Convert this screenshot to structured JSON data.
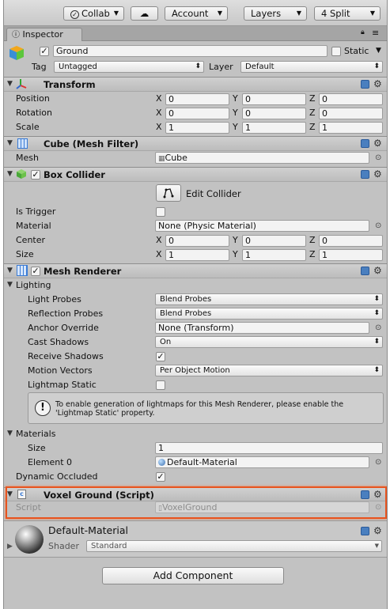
{
  "toolbar": {
    "collab": "Collab",
    "account": "Account",
    "layers": "Layers",
    "layout": "4 Split"
  },
  "tab": {
    "label": "Inspector"
  },
  "object": {
    "name": "Ground",
    "static_label": "Static",
    "tag_label": "Tag",
    "tag_value": "Untagged",
    "layer_label": "Layer",
    "layer_value": "Default"
  },
  "transform": {
    "title": "Transform",
    "position": "Position",
    "rotation": "Rotation",
    "scale": "Scale",
    "x": "X",
    "y": "Y",
    "z": "Z",
    "pos": [
      "0",
      "0",
      "0"
    ],
    "rot": [
      "0",
      "0",
      "0"
    ],
    "scl": [
      "1",
      "1",
      "1"
    ]
  },
  "mesh_filter": {
    "title": "Cube (Mesh Filter)",
    "mesh_label": "Mesh",
    "mesh_value": "Cube"
  },
  "box_collider": {
    "title": "Box Collider",
    "edit": "Edit Collider",
    "is_trigger": "Is Trigger",
    "material_label": "Material",
    "material_value": "None (Physic Material)",
    "center": "Center",
    "size": "Size",
    "center_v": [
      "0",
      "0",
      "0"
    ],
    "size_v": [
      "1",
      "1",
      "1"
    ]
  },
  "mesh_renderer": {
    "title": "Mesh Renderer",
    "lighting": "Lighting",
    "light_probes": "Light Probes",
    "light_probes_v": "Blend Probes",
    "reflection_probes": "Reflection Probes",
    "reflection_probes_v": "Blend Probes",
    "anchor_override": "Anchor Override",
    "anchor_override_v": "None (Transform)",
    "cast_shadows": "Cast Shadows",
    "cast_shadows_v": "On",
    "receive_shadows": "Receive Shadows",
    "motion_vectors": "Motion Vectors",
    "motion_vectors_v": "Per Object Motion",
    "lightmap_static": "Lightmap Static",
    "note": "To enable generation of lightmaps for this Mesh Renderer, please enable the 'Lightmap Static' property.",
    "materials": "Materials",
    "size": "Size",
    "size_v": "1",
    "element0": "Element 0",
    "element0_v": "Default-Material",
    "dynamic_occluded": "Dynamic Occluded"
  },
  "script_comp": {
    "title": "Voxel Ground (Script)",
    "script_label": "Script",
    "script_value": "VoxelGround"
  },
  "material": {
    "name": "Default-Material",
    "shader_label": "Shader",
    "shader_value": "Standard"
  },
  "add_component": "Add Component",
  "colors": {
    "selection": "#e8541f",
    "help": "#4a7fbf",
    "panel": "#c2c2c2"
  }
}
